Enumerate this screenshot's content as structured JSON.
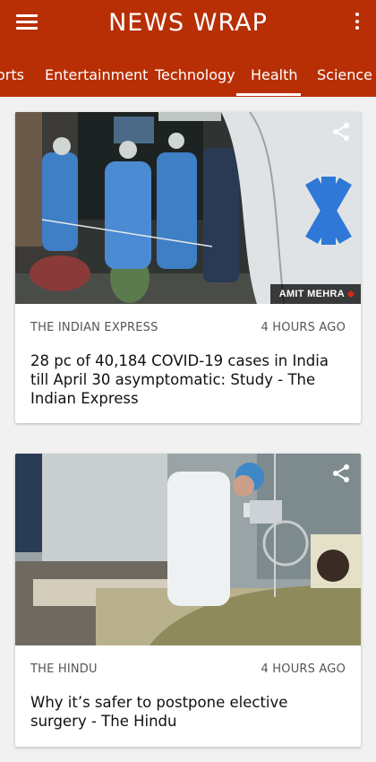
{
  "app": {
    "title": "NEWS WRAP",
    "accent_color": "#b82f06"
  },
  "tabs": [
    {
      "label": "orts"
    },
    {
      "label": "Entertainment"
    },
    {
      "label": "Technology"
    },
    {
      "label": "Health",
      "selected": true
    },
    {
      "label": "Science"
    }
  ],
  "articles": [
    {
      "source": "THE INDIAN EXPRESS",
      "time": "4 HOURS AGO",
      "headline": "28 pc of 40,184 COVID-19 cases in India till April 30 asymptomatic: Study - The Indian Express",
      "photo_credit": "AMIT MEHRA",
      "share_icon": "share-icon"
    },
    {
      "source": "THE HINDU",
      "time": "4 HOURS AGO",
      "headline": "Why it’s safer to postpone elective surgery - The Hindu",
      "share_icon": "share-icon"
    }
  ]
}
